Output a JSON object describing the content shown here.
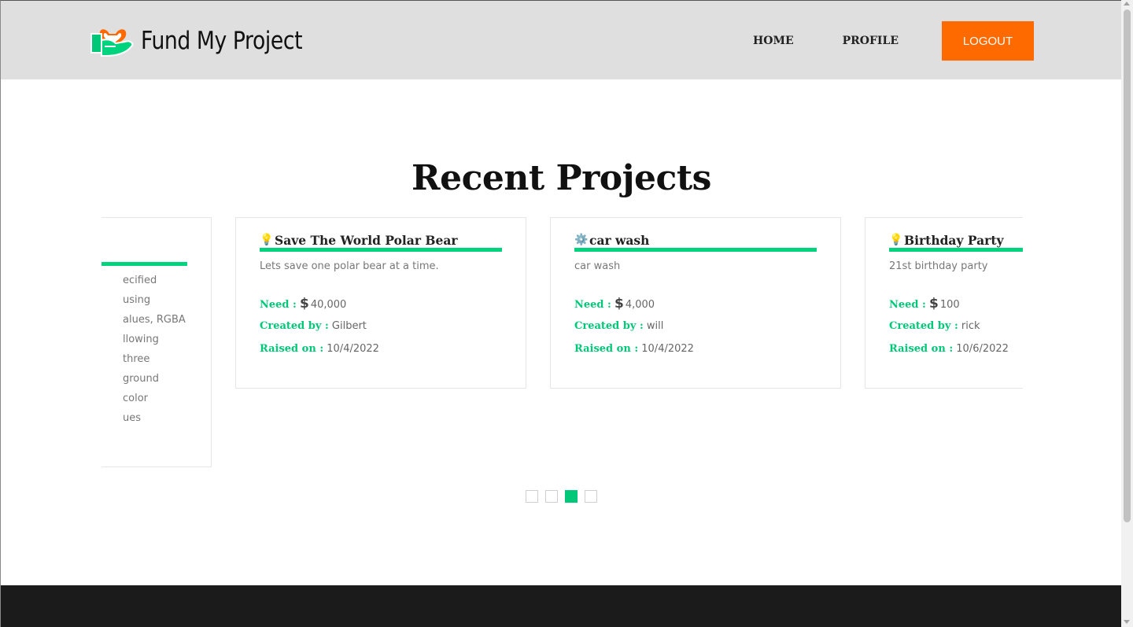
{
  "header": {
    "logo_text": "Fund My Project",
    "nav": {
      "home": "HOME",
      "profile": "PROFILE",
      "logout": "LOGOUT"
    }
  },
  "colors": {
    "accent": "#00d37e",
    "logout": "#ff6a00",
    "header_bg": "#dfdfdf",
    "footer_bg": "#1b1b1b"
  },
  "section": {
    "title": "Recent Projects"
  },
  "partial_card": {
    "desc_lines": [
      "ecified using",
      "alues, RGBA",
      "llowing three",
      "ground color",
      "ues"
    ]
  },
  "projects": [
    {
      "icon": "lightbulb-icon",
      "emoji": "💡",
      "title": "Save The World Polar Bear",
      "description": "Lets save one polar bear at a time.",
      "need_label": "Need :",
      "need_value": "40,000",
      "created_label": "Created by :",
      "created_by": "Gilbert",
      "raised_label": "Raised on :",
      "raised_on": "10/4/2022"
    },
    {
      "icon": "gear-icon",
      "emoji": "⚙️",
      "title": "car wash",
      "description": "car wash",
      "need_label": "Need :",
      "need_value": "4,000",
      "created_label": "Created by :",
      "created_by": "will",
      "raised_label": "Raised on :",
      "raised_on": "10/4/2022"
    },
    {
      "icon": "lightbulb-icon",
      "emoji": "💡",
      "title": "Birthday Party",
      "description": "21st birthday party",
      "need_label": "Need :",
      "need_value": "100",
      "created_label": "Created by :",
      "created_by": "rick",
      "raised_label": "Raised on :",
      "raised_on": "10/6/2022"
    }
  ],
  "currency_symbol": "$",
  "pagination": {
    "pages": 4,
    "active_index": 2
  }
}
